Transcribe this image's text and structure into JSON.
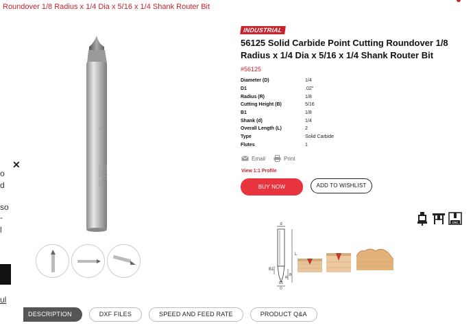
{
  "breadcrumb": "Roundover 1/8 Radius x 1/4 Dia x 5/16 x 1/4 Shank Router Bit",
  "overlay": {
    "chars": [
      "o",
      "d",
      "so",
      "-",
      "l"
    ],
    "link": "ul"
  },
  "product": {
    "badge": "INDUSTRIAL",
    "title": "56125 Solid Carbide Point Cutting Roundover 1/8 Radius x 1/4 Dia x 5/16 x 1/4 Shank Router Bit",
    "sku": "#56125",
    "specs": [
      {
        "label": "Diameter (D)",
        "value": "1/4"
      },
      {
        "label": "D1",
        "value": ".02\""
      },
      {
        "label": "Radius (R)",
        "value": "1/8"
      },
      {
        "label": "Cutting Height (B)",
        "value": "5/16"
      },
      {
        "label": "B1",
        "value": "1/8"
      },
      {
        "label": "Shank (d)",
        "value": "1/4"
      },
      {
        "label": "Overall Length (L)",
        "value": "2"
      },
      {
        "label": "Type",
        "value": "Solid Carbide"
      },
      {
        "label": "Flutes",
        "value": "1"
      }
    ],
    "actions": {
      "email": "Email",
      "print": "Print"
    },
    "profile_link": "View 1:1 Profile",
    "buy_label": "BUY NOW",
    "wishlist_label": "ADD TO WISHLIST"
  },
  "tabs": [
    {
      "label": "DESCRIPTION",
      "active": true
    },
    {
      "label": "DXF FILES",
      "active": false
    },
    {
      "label": "SPEED AND FEED RATE",
      "active": false
    },
    {
      "label": "PRODUCT Q&A",
      "active": false
    }
  ],
  "machine_icons": [
    "handheld-router-icon",
    "router-table-icon",
    "cnc-machine-icon"
  ],
  "diagram_labels": {
    "d": "d",
    "L": "L",
    "B1": "B1",
    "B": "B",
    "R": "R",
    "D1": "D1",
    "D": "D",
    "cnc": "CNC"
  },
  "colors": {
    "accent": "#c8222b",
    "buy": "#e8343e",
    "active_tab": "#555555"
  }
}
